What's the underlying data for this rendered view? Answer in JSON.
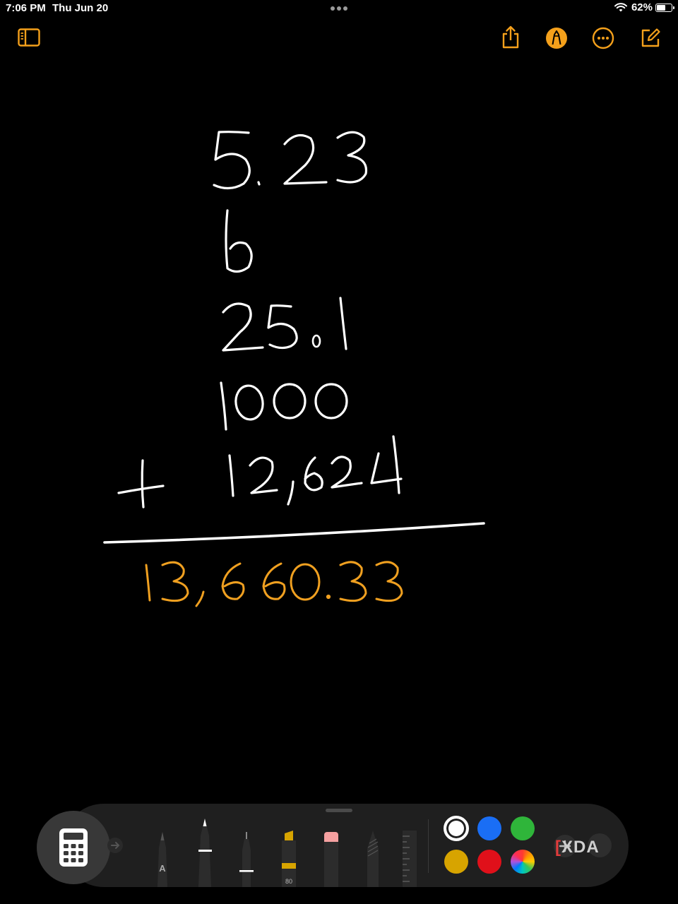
{
  "status_bar": {
    "time": "7:06 PM",
    "date": "Thu Jun 20",
    "battery_percent": "62%",
    "battery_level": 0.62,
    "wifi_icon": "wifi-icon"
  },
  "toolbar": {
    "sidebar_icon": "sidebar-toggle-icon",
    "share_icon": "share-icon",
    "markup_icon": "markup-pen-icon",
    "more_icon": "ellipsis-icon",
    "compose_icon": "compose-icon",
    "accent_color": "#f4a01b"
  },
  "note": {
    "handwritten_lines": [
      "5.23",
      "6",
      "25.1",
      "1000",
      "+ 12,624"
    ],
    "result": "13,660.33",
    "ink_color": "#ffffff",
    "result_color": "#f0a020"
  },
  "palette": {
    "calculator_icon": "calculator-icon",
    "tools": [
      "monoline-pen",
      "pen",
      "fineliner",
      "marker",
      "eraser",
      "pencil",
      "ruler"
    ],
    "marker_width": "80",
    "pen_label": "A",
    "colors": [
      "#ffffff",
      "#1a6ef5",
      "#2fb53a",
      "#d7a400",
      "#e0101a",
      "color-wheel"
    ],
    "selected_color": "#ffffff",
    "add_icon": "plus-icon",
    "watermark": "XDA"
  }
}
